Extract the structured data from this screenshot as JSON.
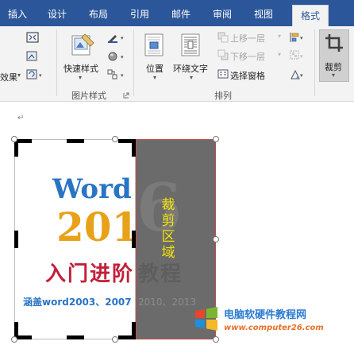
{
  "tabs": [
    {
      "label": "插入"
    },
    {
      "label": "设计"
    },
    {
      "label": "布局"
    },
    {
      "label": "引用"
    },
    {
      "label": "邮件"
    },
    {
      "label": "审阅"
    },
    {
      "label": "视图"
    },
    {
      "label": "格式"
    }
  ],
  "active_tab": "格式",
  "ribbon": {
    "adjust_partial_label": "效果",
    "quick_styles_label": "快速样式",
    "picture_styles_group": "图片样式",
    "position_label": "位置",
    "wrap_text_label": "环绕文字",
    "bring_forward_label": "上移一层",
    "send_backward_label": "下移一层",
    "selection_pane_label": "选择窗格",
    "arrange_group": "排列",
    "crop_label": "裁剪"
  },
  "document": {
    "paragraph_mark": "↵",
    "image_title_word": "Word",
    "image_title_year": "201",
    "image_title_six": "6",
    "image_subtitle": "入门进阶",
    "image_subtitle_rest": "教程",
    "image_cover_text": "涵盖word2003、2007",
    "image_cover_rest": "2010、2013",
    "crop_area_label": "裁剪区域"
  },
  "watermark": {
    "site_name": "电脑软硬件教程网",
    "url": "www.computer26.com"
  },
  "colors": {
    "tab_bar": "#2b579a",
    "ribbon_bg": "#f3f3f3",
    "crop_area": "#6b6b6b",
    "crop_text": "#f5e400"
  }
}
